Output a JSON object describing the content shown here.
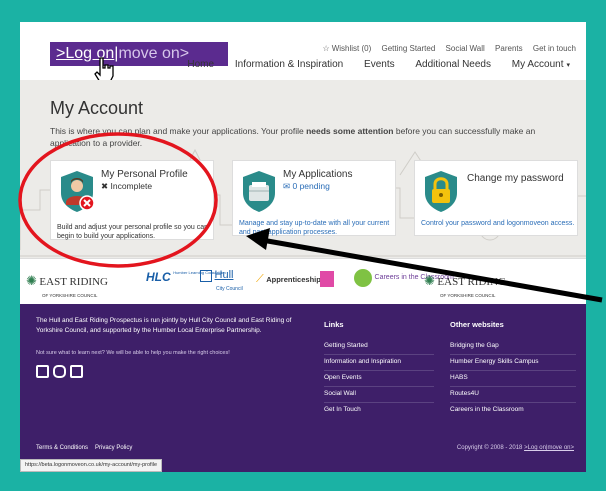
{
  "header": {
    "logo": {
      "part1": ">Log on",
      "sep": "|",
      "part2": "move on>"
    },
    "top_links": [
      "Wishlist (0)",
      "Getting Started",
      "Social Wall",
      "Parents",
      "Get in touch"
    ],
    "main_nav": [
      "Home",
      "Information & Inspiration",
      "Events",
      "Additional Needs",
      "My Account"
    ]
  },
  "page": {
    "title": "My Account",
    "intro_before": "This is where you can plan and make your applications. Your profile ",
    "intro_bold": "needs some attention",
    "intro_after": " before you can successfully make an application to a provider."
  },
  "cards": {
    "profile": {
      "title": "My Personal Profile",
      "status": "Incomplete",
      "desc": "Build and adjust your personal profile so you can begin to build your applications."
    },
    "applications": {
      "title": "My Applications",
      "status": "0 pending",
      "desc": "Manage and stay up-to-date with all your current and past application processes."
    },
    "password": {
      "title": "Change my password",
      "desc": "Control your password and logonmoveon access."
    }
  },
  "partners": [
    "EAST RIDING",
    "OF YORKSHIRE COUNCIL",
    "HLC",
    "Humber Learning Consortium",
    "Hull",
    "City Council",
    "Apprenticeships",
    "Careers in the Classroom",
    "EAST RIDING",
    "OF YORKSHIRE COUNCIL"
  ],
  "footer": {
    "about": "The Hull and East Riding Prospectus is run jointly by Hull City Council and East Riding of Yorkshire Council, and supported by the Humber Local Enterprise Partnership.",
    "note": "Not sure what to learn next? We will be able to help you make the right choices!",
    "links_heading": "Links",
    "links": [
      "Getting Started",
      "Information and Inspiration",
      "Open Events",
      "Social Wall",
      "Get In Touch"
    ],
    "other_heading": "Other websites",
    "other": [
      "Bridging the Gap",
      "Humber Energy Skills Campus",
      "HABS",
      "Routes4U",
      "Careers in the Classroom"
    ],
    "terms": "Terms & Conditions",
    "privacy": "Privacy Policy",
    "copyright_text": "Copyright © 2008 - 2018 ",
    "copyright_logo": ">Log on|move on>",
    "status_url": "https://beta.logonmoveon.co.uk/my-account/my-profile"
  },
  "colors": {
    "border": "#1bb2a4",
    "brand": "#5b2b8f",
    "footer": "#3e1f69",
    "link": "#2a6db7",
    "highlight": "#e3151e",
    "shield": "#2a8b8a"
  },
  "icons": [
    "star-icon",
    "chevron-down-icon",
    "hand-cursor-icon",
    "person-shield-icon",
    "error-badge-icon",
    "cross-icon",
    "envelope-icon",
    "folder-shield-icon",
    "lock-shield-icon",
    "facebook-icon",
    "instagram-icon",
    "twitter-icon"
  ]
}
